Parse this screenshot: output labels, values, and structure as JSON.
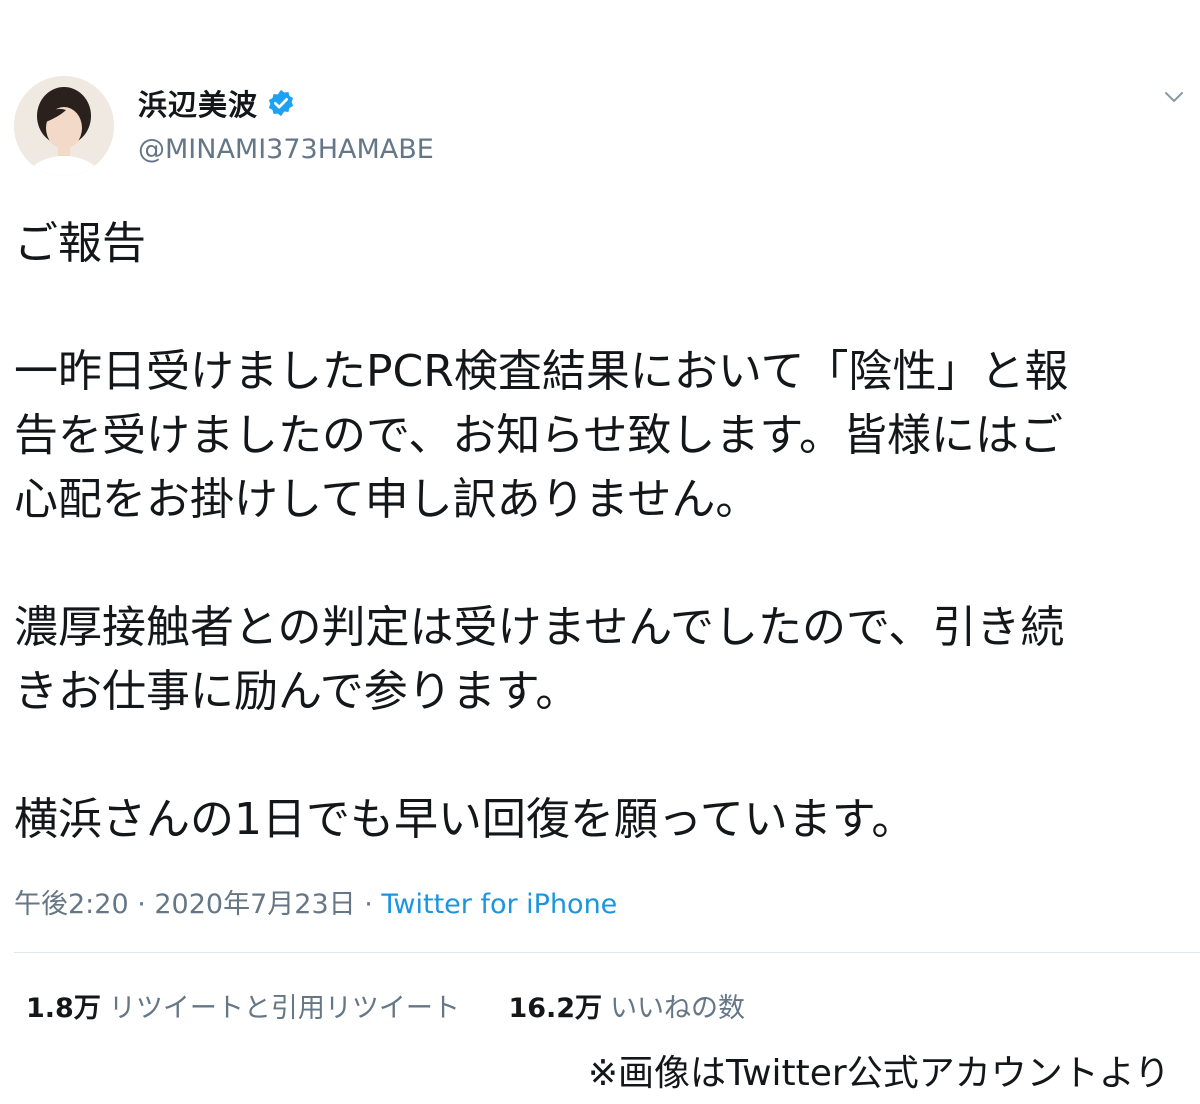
{
  "user": {
    "display_name": "浜辺美波",
    "handle": "@MINAMI373HAMABE",
    "verified_icon": "verified-badge-icon",
    "avatar_icon": "profile-photo",
    "more_icon": "chevron-down-icon"
  },
  "tweet": {
    "lines": {
      "l1": "ご報告",
      "l2": "一昨日受けましたPCR検査結果において「陰性」と報",
      "l3": "告を受けましたので、お知らせ致します。皆様にはご",
      "l4": "心配をお掛けして申し訳ありません。",
      "l5": "濃厚接触者との判定は受けませんでしたので、引き続",
      "l6": "きお仕事に励んで参ります。",
      "l7": "横浜さんの1日でも早い回復を願っています。"
    },
    "timestamp": "午後2:20 · 2020年7月23日 · ",
    "source": "Twitter for iPhone"
  },
  "stats": {
    "retweets_count": "1.8万",
    "retweets_label": "リツイートと引用リツイート",
    "likes_count": "16.2万",
    "likes_label": "いいねの数"
  },
  "credit": "※画像はTwitter公式アカウントより",
  "colors": {
    "text": "#14171a",
    "secondary": "#657786",
    "link": "#1b95e0",
    "verified": "#1da1f2",
    "divider": "#e1e8ed"
  }
}
